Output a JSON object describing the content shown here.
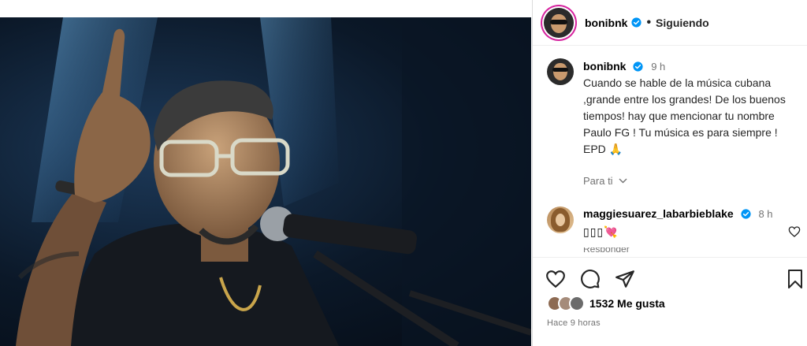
{
  "post": {
    "author": "bonibnk",
    "follow_state": "Siguiendo",
    "separator": "•"
  },
  "caption": {
    "username": "bonibnk",
    "time": "9 h",
    "text": "Cuando se hable de la música cubana ,grande entre los grandes! De los buenos tiempos! hay que mencionar tu nombre Paulo FG ! Tu música es para siempre ! EPD 🙏",
    "see_translation": "Para ti"
  },
  "comment": {
    "username": "maggiesuarez_labarbieblake",
    "time": "8 h",
    "text": "▯▯▯💘",
    "reply_hint": "Responder"
  },
  "engagement": {
    "likes": "1532 Me gusta",
    "posted": "Hace 9 horas"
  },
  "icons": {
    "like": "heart-icon",
    "comment": "comment-icon",
    "share": "share-icon",
    "save": "bookmark-icon",
    "verified": "verified-badge-icon"
  },
  "colors": {
    "verified": "#0095f6",
    "story_ring": "#d6249f",
    "muted_text": "#737373"
  }
}
